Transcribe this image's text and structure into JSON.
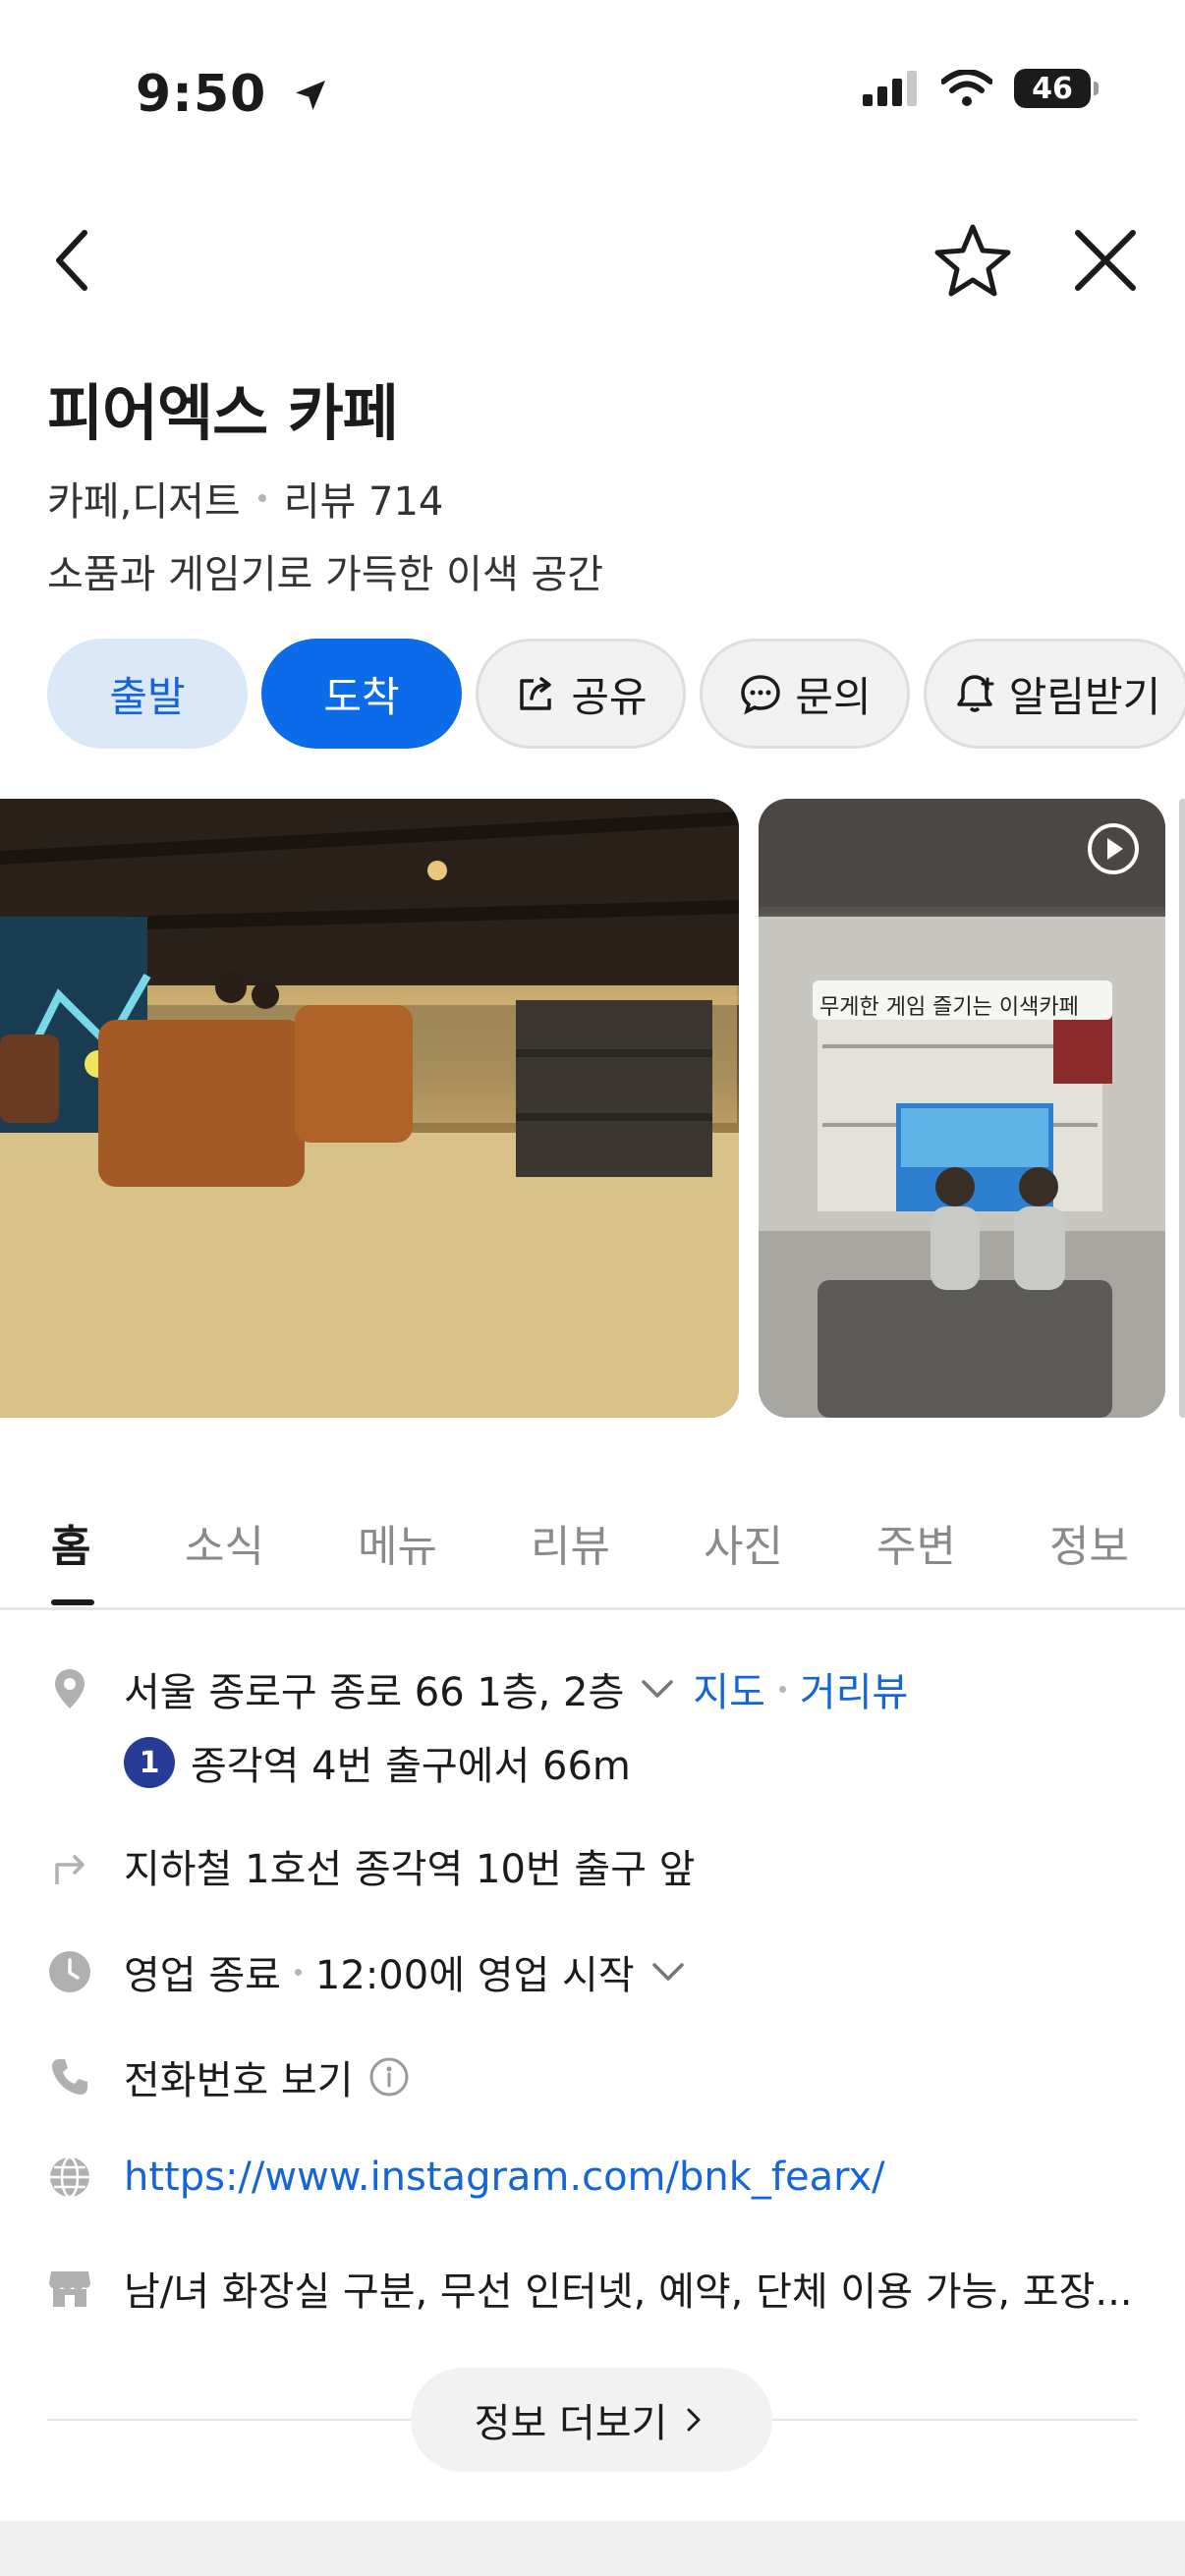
{
  "status_bar": {
    "time": "9:50",
    "battery": "46"
  },
  "header": {
    "back_icon": "chevron-left-icon",
    "favorite_icon": "star-outline-icon",
    "close_icon": "close-icon"
  },
  "place": {
    "title": "피어엑스 카페",
    "category": "카페,디저트",
    "reviews": "리뷰 714",
    "description": "소품과 게임기로 가득한 이색 공간"
  },
  "actions": {
    "depart": "출발",
    "arrive": "도착",
    "share": "공유",
    "inquiry": "문의",
    "notify": "알림받기"
  },
  "photos": {
    "overlay_text": "무게한 게임 즐기는 이색카페"
  },
  "tabs": [
    "홈",
    "소식",
    "메뉴",
    "리뷰",
    "사진",
    "주변",
    "정보"
  ],
  "info": {
    "address": "서울 종로구 종로 66 1층, 2층",
    "map_link": "지도",
    "street_view_link": "거리뷰",
    "subway_line": "1",
    "subway_text": "종각역 4번 출구에서 66m",
    "directions": "지하철 1호선 종각역 10번 출구 앞",
    "hours_status": "영업 종료",
    "hours_next": "12:00에 영업 시작",
    "phone": "전화번호 보기",
    "website": "https://www.instagram.com/bnk_fearx/",
    "amenities": "남/녀 화장실 구분, 무선 인터넷, 예약, 단체 이용 가능, 포장..."
  },
  "more_button": "정보 더보기",
  "colors": {
    "accent": "#0b6be8",
    "link": "#1565d8",
    "subway_line1": "#263c96"
  }
}
